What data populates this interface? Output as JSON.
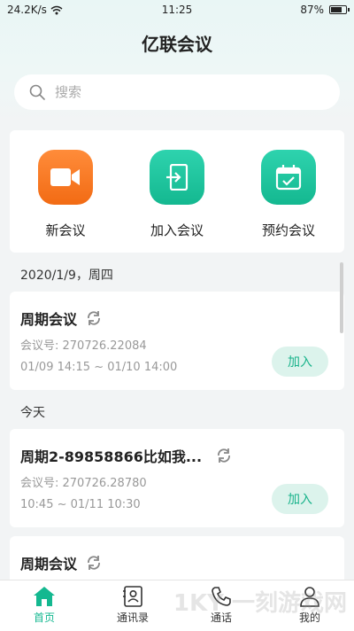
{
  "status": {
    "net_speed": "24.2K/s",
    "time": "11:25",
    "battery": "87%",
    "battery_level": 0.87
  },
  "header": {
    "title": "亿联会议"
  },
  "search": {
    "placeholder": "搜索"
  },
  "actions": [
    {
      "label": "新会议",
      "icon": "video-camera-icon"
    },
    {
      "label": "加入会议",
      "icon": "enter-door-icon"
    },
    {
      "label": "预约会议",
      "icon": "calendar-check-icon"
    }
  ],
  "sections": [
    {
      "label": "2020/1/9，周四"
    },
    {
      "label": "今天"
    }
  ],
  "meetings": [
    {
      "title": "周期会议",
      "number": "会议号: 270726.22084",
      "time": "01/09 14:15 ~ 01/10 14:00",
      "join": "加入"
    },
    {
      "title": "周期2-89858866比如我...",
      "number": "会议号: 270726.28780",
      "time": "10:45 ~ 01/11 10:30",
      "join": "加入"
    },
    {
      "title": "周期会议"
    }
  ],
  "tabs": [
    {
      "label": "首页",
      "icon": "home-icon",
      "active": true
    },
    {
      "label": "通讯录",
      "icon": "contacts-icon"
    },
    {
      "label": "通话",
      "icon": "phone-icon"
    },
    {
      "label": "我的",
      "icon": "user-icon"
    }
  ],
  "watermark": "1KY 一刻游戏网",
  "colors": {
    "accent": "#14b890",
    "orange": "#f26b14",
    "join_bg": "#dcf3ec"
  }
}
